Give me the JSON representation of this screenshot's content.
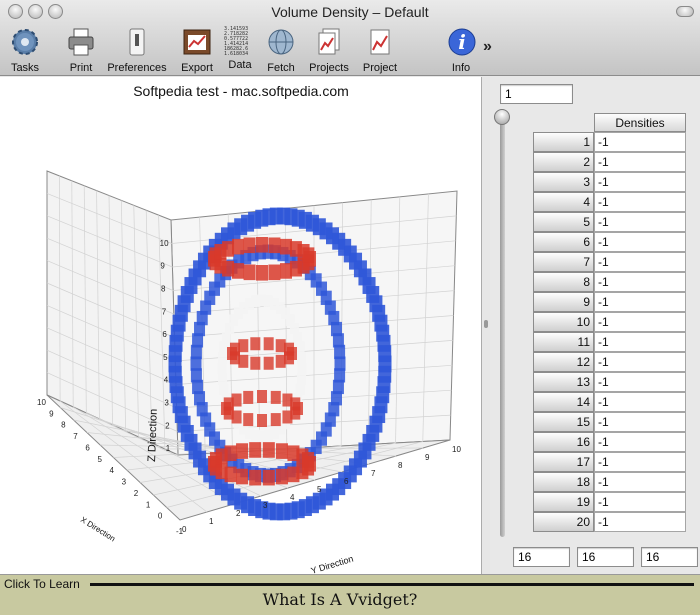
{
  "window": {
    "title": "Volume Density – Default"
  },
  "toolbar": {
    "items": [
      {
        "label": "Tasks",
        "icon": "gear-icon"
      },
      {
        "label": "Print",
        "icon": "printer-icon"
      },
      {
        "label": "Preferences",
        "icon": "switch-icon"
      },
      {
        "label": "Export",
        "icon": "graph-frame-icon"
      },
      {
        "label": "Data",
        "icon": "numbers-icon"
      },
      {
        "label": "Fetch",
        "icon": "globe-icon"
      },
      {
        "label": "Projects",
        "icon": "documents-icon"
      },
      {
        "label": "Project",
        "icon": "document-graph-icon"
      },
      {
        "label": "Info",
        "icon": "info-icon"
      }
    ],
    "overflow": "»",
    "data_icon_text": [
      "3.141593",
      "2.718282",
      "0.577722",
      "1.414214",
      "186282.6",
      "1.618034"
    ]
  },
  "plot": {
    "title": "Softpedia test - mac.softpedia.com",
    "z_label": "Z Direction",
    "y_label": "Y Direction",
    "x_label": "X Direction",
    "z_ticks": [
      "1",
      "2",
      "3",
      "4",
      "5",
      "6",
      "7",
      "8",
      "9",
      "10"
    ],
    "y_ticks": [
      "0",
      "1",
      "2",
      "3",
      "4",
      "5",
      "6",
      "7",
      "8",
      "9",
      "10"
    ],
    "x_ticks": [
      "-1",
      "0",
      "1",
      "2",
      "3",
      "4",
      "5",
      "6",
      "7",
      "8",
      "9",
      "10"
    ],
    "colors": {
      "red": "#d83a2a",
      "blue": "#2f57d8",
      "white": "#f4f4f4"
    }
  },
  "panel": {
    "index_value": "1",
    "column_header": "Densities",
    "rows": [
      {
        "n": "1",
        "v": "-1"
      },
      {
        "n": "2",
        "v": "-1"
      },
      {
        "n": "3",
        "v": "-1"
      },
      {
        "n": "4",
        "v": "-1"
      },
      {
        "n": "5",
        "v": "-1"
      },
      {
        "n": "6",
        "v": "-1"
      },
      {
        "n": "7",
        "v": "-1"
      },
      {
        "n": "8",
        "v": "-1"
      },
      {
        "n": "9",
        "v": "-1"
      },
      {
        "n": "10",
        "v": "-1"
      },
      {
        "n": "11",
        "v": "-1"
      },
      {
        "n": "12",
        "v": "-1"
      },
      {
        "n": "13",
        "v": "-1"
      },
      {
        "n": "14",
        "v": "-1"
      },
      {
        "n": "15",
        "v": "-1"
      },
      {
        "n": "16",
        "v": "-1"
      },
      {
        "n": "17",
        "v": "-1"
      },
      {
        "n": "18",
        "v": "-1"
      },
      {
        "n": "19",
        "v": "-1"
      },
      {
        "n": "20",
        "v": "-1"
      }
    ],
    "dims": [
      "16",
      "16",
      "16"
    ]
  },
  "footer": {
    "learn": "Click To Learn",
    "caption": "What Is A Vvidget?"
  }
}
